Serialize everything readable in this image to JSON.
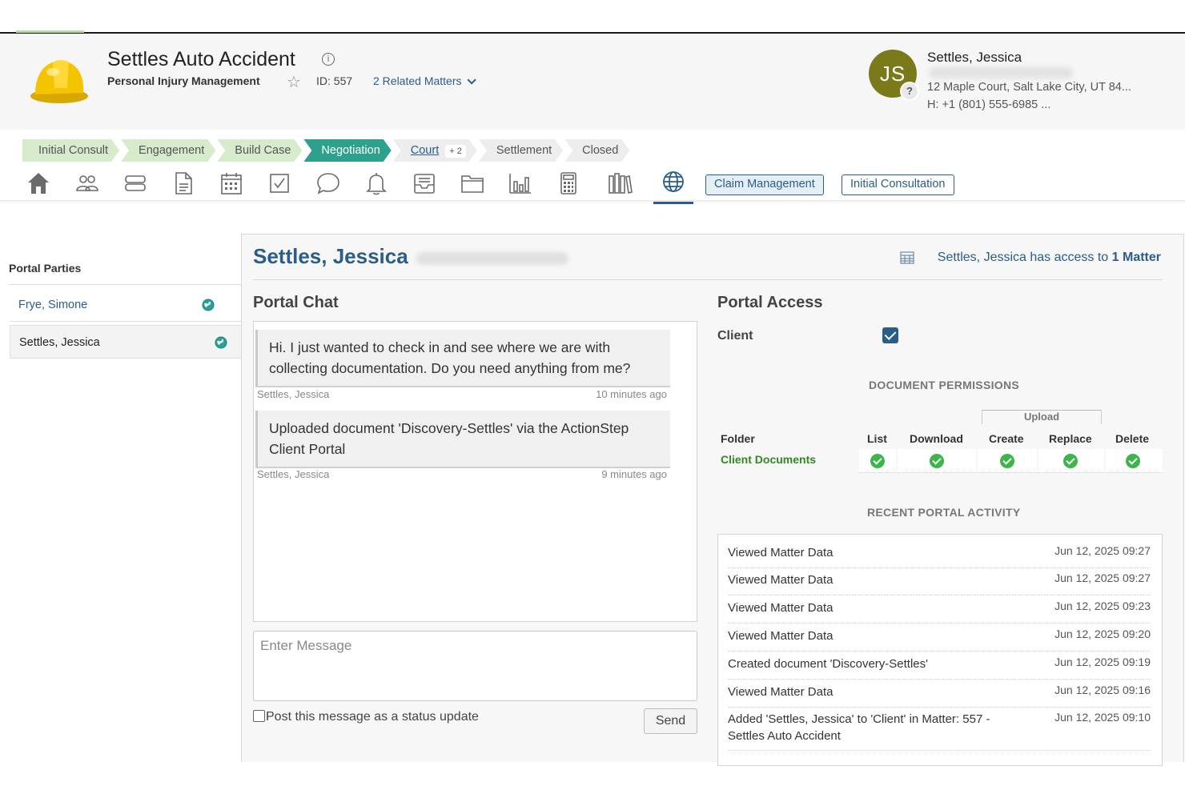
{
  "header": {
    "matter_title": "Settles Auto Accident",
    "matter_type": "Personal Injury Management",
    "matter_id": "ID: 557",
    "related_matters": "2 Related Matters",
    "contact": {
      "initials": "JS",
      "name": "Settles, Jessica",
      "address": "12 Maple Court, Salt Lake City, UT 84...",
      "phone": "H: +1 (801) 555-6985  ..."
    }
  },
  "stages": [
    {
      "label": "Initial Consult",
      "state": "done"
    },
    {
      "label": "Engagement",
      "state": "done"
    },
    {
      "label": "Build Case",
      "state": "done"
    },
    {
      "label": "Negotiation",
      "state": "active"
    },
    {
      "label": "Court",
      "state": "future",
      "badge": "+ 2"
    },
    {
      "label": "Settlement",
      "state": "future"
    },
    {
      "label": "Closed",
      "state": "future"
    }
  ],
  "toolbar": {
    "icons": [
      "home-icon",
      "people-icon",
      "stack-icon",
      "document-icon",
      "calendar-icon",
      "checkbox-icon",
      "chat-icon",
      "bell-icon",
      "inbox-icon",
      "folder-icon",
      "chart-icon",
      "calculator-icon",
      "library-icon",
      "globe-icon"
    ],
    "pill_claim": "Claim Management",
    "pill_consult": "Initial Consultation"
  },
  "left_panel": {
    "title": "Portal Parties",
    "parties": [
      "Frye, Simone",
      "Settles, Jessica"
    ]
  },
  "main": {
    "name": "Settles, Jessica",
    "access_prefix": "Settles, Jessica has access to ",
    "access_count": "1 Matter",
    "chat": {
      "title": "Portal Chat",
      "messages": [
        {
          "text": "Hi. I just wanted to check in and see where we are with collecting documentation. Do you need anything from me?",
          "author": "Settles, Jessica",
          "time": "10 minutes ago"
        },
        {
          "text": "Uploaded document 'Discovery-Settles' via the ActionStep Client Portal",
          "author": "Settles, Jessica",
          "time": "9 minutes ago"
        }
      ],
      "placeholder": "Enter Message",
      "status_label": "Post this message as a status update",
      "send_label": "Send"
    },
    "access": {
      "title": "Portal Access",
      "client_label": "Client",
      "client_checked": true,
      "doc_perm_title": "DOCUMENT PERMISSIONS",
      "upload_label": "Upload",
      "headers": [
        "Folder",
        "List",
        "Download",
        "Create",
        "Replace",
        "Delete"
      ],
      "folder": "Client Documents",
      "recent_title": "RECENT PORTAL ACTIVITY",
      "activity": [
        {
          "desc": "Viewed Matter Data",
          "time": "Jun 12, 2025 09:27"
        },
        {
          "desc": "Viewed Matter Data",
          "time": "Jun 12, 2025 09:27"
        },
        {
          "desc": "Viewed Matter Data",
          "time": "Jun 12, 2025 09:23"
        },
        {
          "desc": "Viewed Matter Data",
          "time": "Jun 12, 2025 09:20"
        },
        {
          "desc": "Created document 'Discovery-Settles'",
          "time": "Jun 12, 2025 09:19"
        },
        {
          "desc": "Viewed Matter Data",
          "time": "Jun 12, 2025 09:16"
        },
        {
          "desc": "Added 'Settles, Jessica' to 'Client' in Matter: 557 - Settles Auto Accident",
          "time": "Jun 12, 2025 09:10"
        }
      ]
    }
  },
  "colors": {
    "accent": "#2a5d8a",
    "stage_active": "#2ea08e",
    "stage_done": "#d6ebcb",
    "permission_ok": "#3cb54a"
  }
}
